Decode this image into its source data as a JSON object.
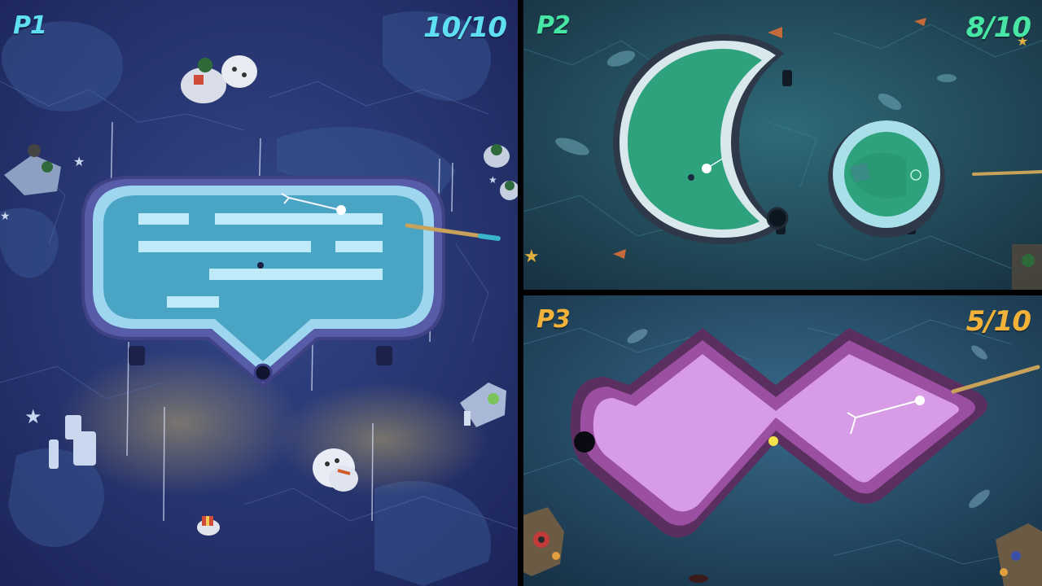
{
  "players": [
    {
      "label": "P1",
      "score": "10/10",
      "color": "#5fe0f2",
      "course": "ice-speech-bubble-course"
    },
    {
      "label": "P2",
      "score": "8/10",
      "color": "#47e6a5",
      "course": "green-crescent-course"
    },
    {
      "label": "P3",
      "score": "5/10",
      "color": "#f2b23a",
      "course": "purple-zigzag-course"
    }
  ],
  "colors": {
    "p1_water": "#23306e",
    "p2_water": "#1f4a5c",
    "p3_water": "#244a63",
    "p2_green": "#2ea17d",
    "p3_purple": "#d89ce6",
    "divider": "#000000"
  }
}
